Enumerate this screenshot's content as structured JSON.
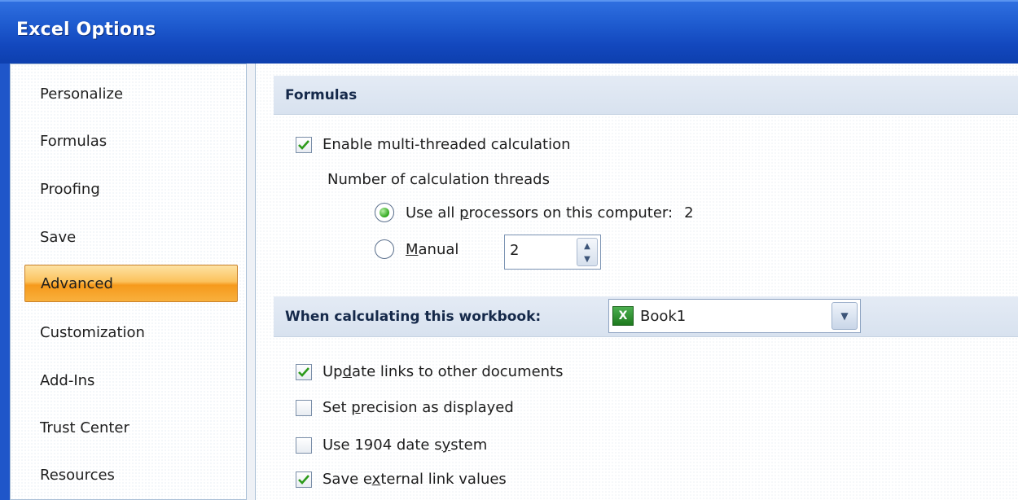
{
  "window": {
    "title": "Excel Options"
  },
  "sidebar": {
    "items": [
      {
        "label": "Personalize",
        "selected": false
      },
      {
        "label": "Formulas",
        "selected": false
      },
      {
        "label": "Proofing",
        "selected": false
      },
      {
        "label": "Save",
        "selected": false
      },
      {
        "label": "Advanced",
        "selected": true
      },
      {
        "label": "Customization",
        "selected": false
      },
      {
        "label": "Add-Ins",
        "selected": false
      },
      {
        "label": "Trust Center",
        "selected": false
      },
      {
        "label": "Resources",
        "selected": false
      }
    ]
  },
  "formulas_section": {
    "header": "Formulas",
    "multithread": {
      "label": "Enable multi-threaded calculation",
      "checked": true
    },
    "threads_label": "Number of calculation threads",
    "use_all": {
      "label_pre": "Use all ",
      "label_u": "p",
      "label_post": "rocessors on this computer:",
      "value": "2",
      "selected": true
    },
    "manual": {
      "label_u": "M",
      "label_post": "anual",
      "selected": false
    },
    "manual_value": "2"
  },
  "workbook_section": {
    "header": "When calculating this workbook:",
    "workbook": "Book1",
    "workbook_icon": "excel-workbook-icon",
    "options": [
      {
        "pre": "Up",
        "u": "d",
        "post": "ate links to other documents",
        "checked": true
      },
      {
        "pre": "Set ",
        "u": "p",
        "post": "recision as displayed",
        "checked": false
      },
      {
        "pre": "Use 1904 date s",
        "u": "y",
        "post": "stem",
        "checked": false
      },
      {
        "pre": "Save e",
        "u": "x",
        "post": "ternal link values",
        "checked": true
      }
    ]
  },
  "colors": {
    "titlebar": "#1f5cd0",
    "selected_nav": "#f8b03d",
    "radio_selected": "#2fa61c",
    "check": "#2c9a1a"
  }
}
